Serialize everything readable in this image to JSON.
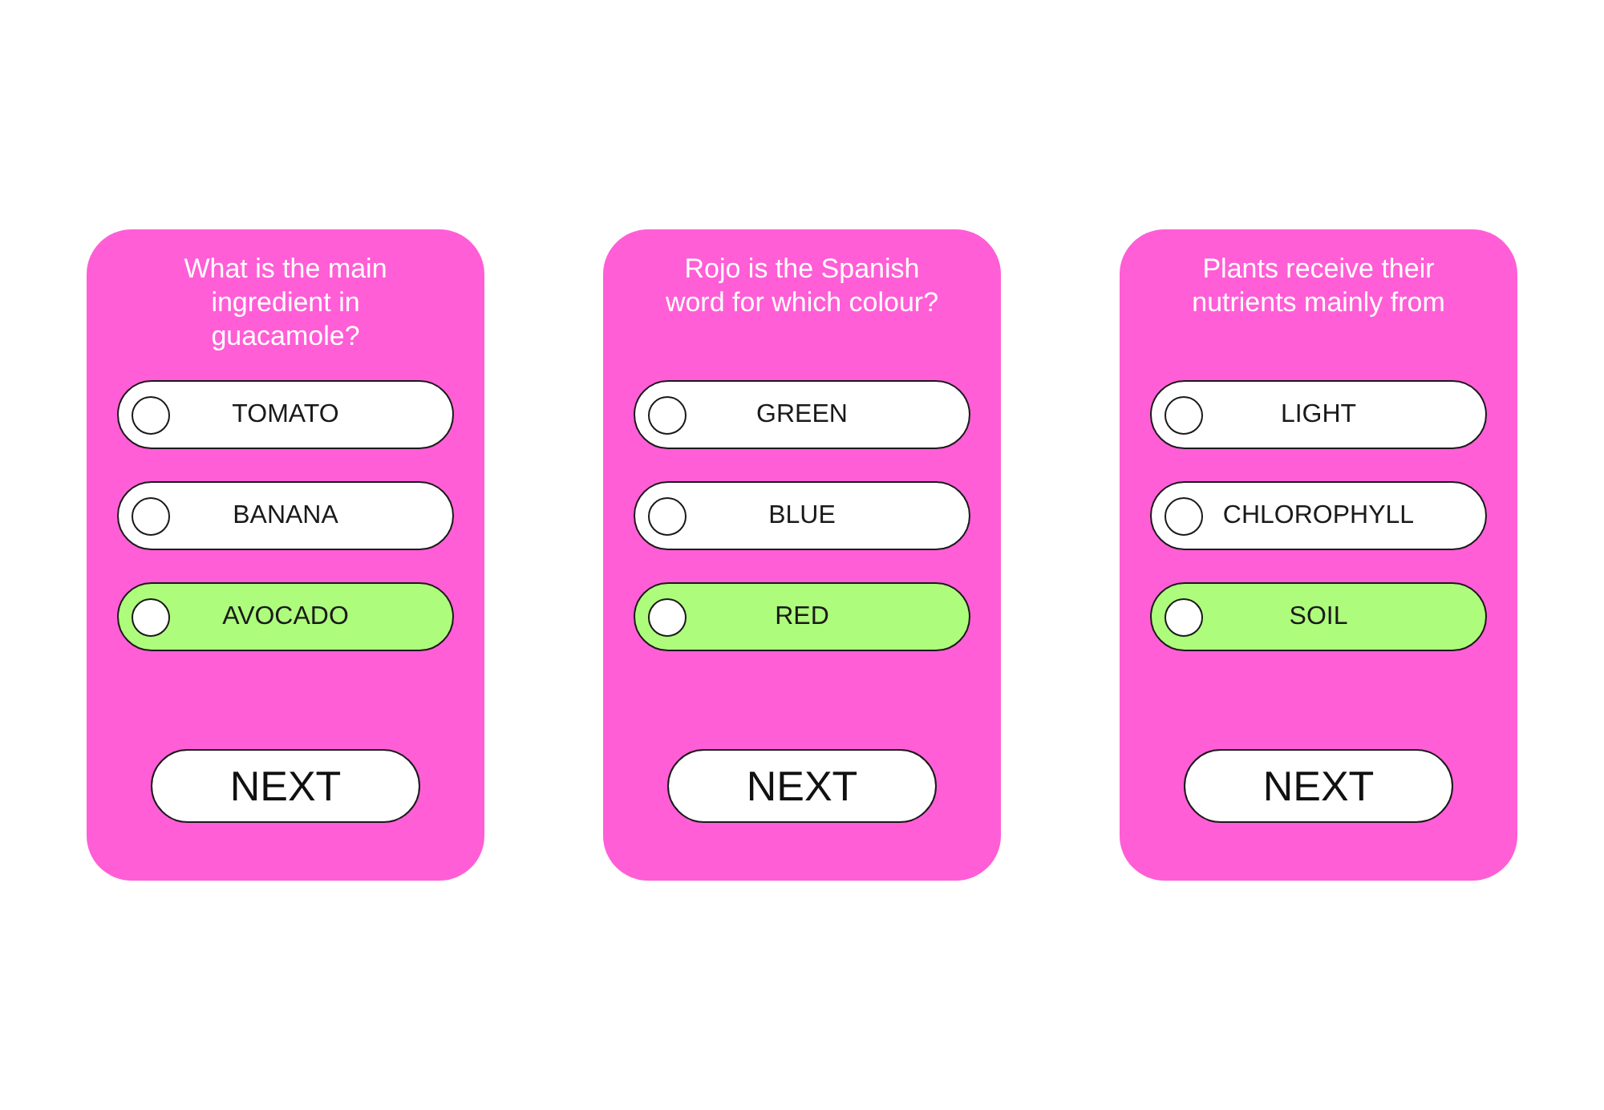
{
  "cards": [
    {
      "question": "What is the main ingredient in guacamole?",
      "options": [
        {
          "label": "TOMATO",
          "selected": false
        },
        {
          "label": "BANANA",
          "selected": false
        },
        {
          "label": "AVOCADO",
          "selected": true
        }
      ],
      "next_button": "NEXT"
    },
    {
      "question": "Rojo is the Spanish word for which colour?",
      "options": [
        {
          "label": "GREEN",
          "selected": false
        },
        {
          "label": "BLUE",
          "selected": false
        },
        {
          "label": "RED",
          "selected": true
        }
      ],
      "next_button": "NEXT"
    },
    {
      "question": "Plants receive their nutrients mainly from",
      "options": [
        {
          "label": "LIGHT",
          "selected": false
        },
        {
          "label": "CHLOROPHYLL",
          "selected": false
        },
        {
          "label": "SOIL",
          "selected": true
        }
      ],
      "next_button": "NEXT"
    }
  ]
}
